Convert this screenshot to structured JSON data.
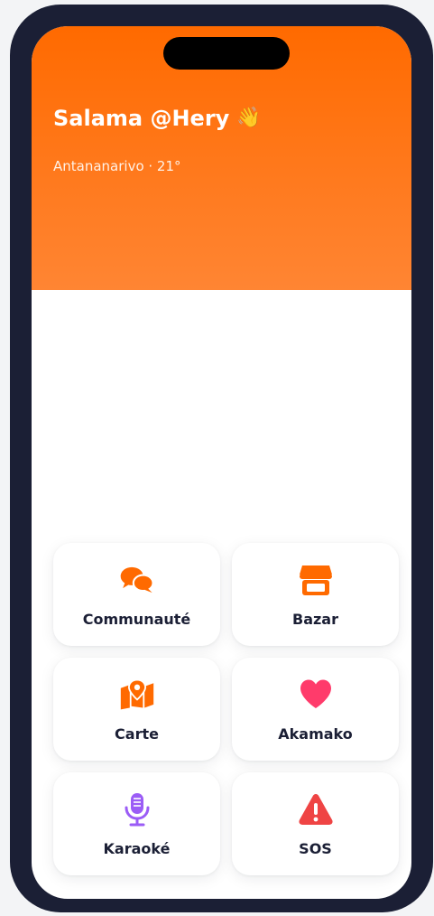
{
  "header": {
    "greeting": "Salama @Hery",
    "wave_emoji": "👋",
    "location": "Antananarivo · 21°"
  },
  "tiles": [
    {
      "label": "Communauté",
      "icon": "chat-bubbles-icon",
      "color": "#ff6a00"
    },
    {
      "label": "Bazar",
      "icon": "store-icon",
      "color": "#ff6a00"
    },
    {
      "label": "Carte",
      "icon": "map-pin-icon",
      "color": "#ff6a00"
    },
    {
      "label": "Akamako",
      "icon": "heart-icon",
      "color": "#ff3b6b"
    },
    {
      "label": "Karaoké",
      "icon": "microphone-icon",
      "color": "#9b5cf6"
    },
    {
      "label": "SOS",
      "icon": "warning-icon",
      "color": "#ef4444"
    }
  ],
  "colors": {
    "frame": "#1b1f35",
    "header_top": "#ff6a00",
    "header_bottom": "#ff8533",
    "text_dark": "#1b1f35"
  }
}
